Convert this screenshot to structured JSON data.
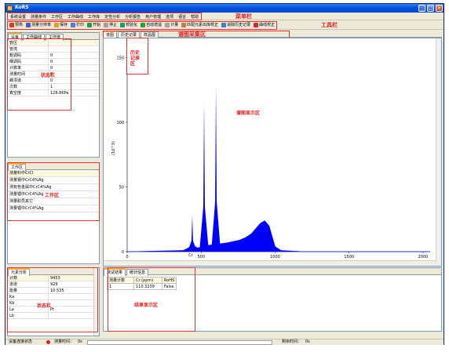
{
  "window": {
    "title": "KoRS"
  },
  "menu": {
    "items": [
      "系统设置",
      "测量条件",
      "工作区",
      "工作曲线",
      "工作库",
      "定性分析",
      "分析报告",
      "用户管理",
      "选项",
      "语言",
      "帮助"
    ]
  },
  "toolbar": {
    "items": [
      "预热",
      "测量分辨率",
      "保存",
      "打印",
      "开始",
      "停止",
      "校验化",
      "自动增益",
      "计量",
      "匹配元素出库校正",
      "追踪历史记录",
      "曲线校正"
    ]
  },
  "annotations": {
    "menubar": "菜单栏",
    "toolbar": "工具栏",
    "spectrum_area": "谱图采集区",
    "history": "历史\n记录\n区",
    "spectrum_display": "谱图显示区",
    "status1": "状态栏",
    "work": "工作区",
    "status2": "状态栏",
    "result": "结果显示区"
  },
  "status_panel": {
    "tabs": [
      "设备",
      "工作曲线",
      "工作谱"
    ],
    "rows": [
      {
        "k": "管压",
        "v": ""
      },
      {
        "k": "管流",
        "v": ""
      },
      {
        "k": "粗调码",
        "v": "0"
      },
      {
        "k": "细调码",
        "v": "0"
      },
      {
        "k": "计数率",
        "v": "0"
      },
      {
        "k": "测量时间",
        "v": "0"
      },
      {
        "k": "峰漂道",
        "v": "0"
      },
      {
        "k": "次数",
        "v": "1"
      },
      {
        "k": "真空度",
        "v": "128.8KPa"
      }
    ]
  },
  "work_panel": {
    "tabs": [
      "工作区"
    ],
    "items": [
      "测量料中CrCl",
      "测量钢中CrC4%Ag",
      "测有色金属中CrC4%Ag",
      "测量锂中CrC4%Ag",
      "测量职员其它",
      "测量锂中CrC4%Ag"
    ]
  },
  "spec_panel": {
    "tabs": [
      "元素分析"
    ],
    "rows": [
      {
        "k": "计数",
        "v": "9453"
      },
      {
        "k": "道道",
        "v": "929"
      },
      {
        "k": "能量",
        "v": "10.535"
      },
      {
        "k": "Ka",
        "v": ""
      },
      {
        "k": "Kb",
        "v": ""
      },
      {
        "k": "La",
        "v": "Pt"
      },
      {
        "k": "Lb",
        "v": ""
      }
    ]
  },
  "chart_tabs": [
    "谱图",
    "历史记录",
    "样品图"
  ],
  "result_tabs": [
    "测试结果",
    "统计信息"
  ],
  "result_table": {
    "headers": [
      "测量计数",
      "Cr (ppm)",
      "RoHS"
    ],
    "rows": [
      [
        "1",
        "110.3239",
        "False"
      ]
    ]
  },
  "statusbar": {
    "device": "设备连接状态",
    "measure_time_label": "测量时间：",
    "measure_time_value": "0s",
    "remain_label": "剩余时间：",
    "remain_value": "0s"
  },
  "colors": {
    "spectrum": "#0000ff",
    "annotation": "#e02020"
  },
  "chart_data": {
    "type": "area",
    "ylabel": "(10^3)",
    "xlim": [
      0,
      2048
    ],
    "ylim": [
      0,
      160
    ],
    "xticks": [
      0,
      500,
      1000,
      1500,
      2000
    ],
    "yticks": [
      0,
      50,
      100,
      150
    ],
    "marker": "Cr",
    "peaks": [
      {
        "x": 440,
        "y": 28
      },
      {
        "x": 465,
        "y": 5
      },
      {
        "x": 520,
        "y": 115
      },
      {
        "x": 600,
        "y": 128
      },
      {
        "x": 640,
        "y": 6
      }
    ],
    "background": [
      [
        0,
        0
      ],
      [
        380,
        1
      ],
      [
        430,
        4
      ],
      [
        480,
        3
      ],
      [
        550,
        5
      ],
      [
        620,
        6
      ],
      [
        680,
        7
      ],
      [
        720,
        8
      ],
      [
        760,
        9
      ],
      [
        800,
        11
      ],
      [
        840,
        14
      ],
      [
        870,
        18
      ],
      [
        900,
        22
      ],
      [
        930,
        24
      ],
      [
        960,
        20
      ],
      [
        980,
        12
      ],
      [
        1000,
        4
      ],
      [
        1040,
        1
      ],
      [
        1200,
        0
      ],
      [
        2048,
        0
      ]
    ]
  }
}
